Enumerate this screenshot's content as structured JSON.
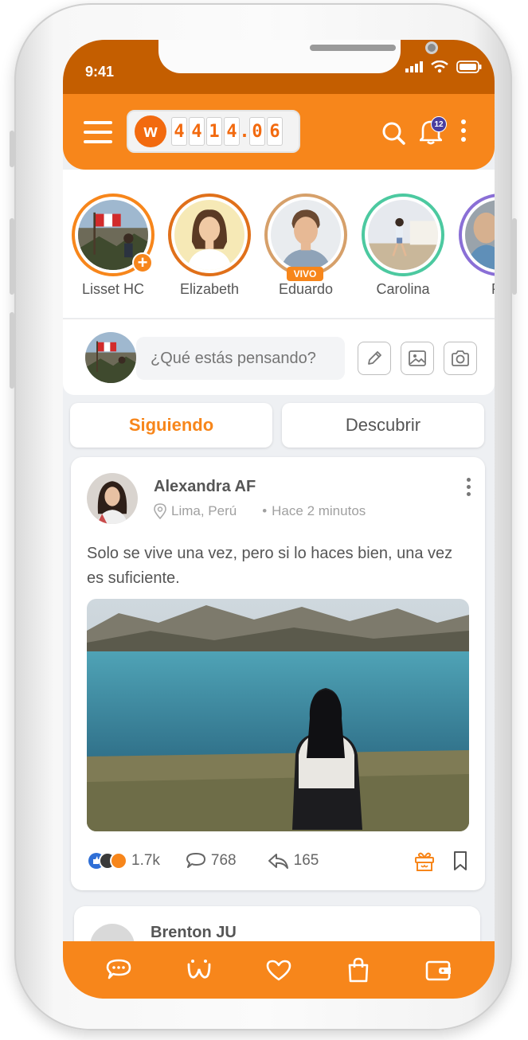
{
  "status_bar": {
    "time": "9:41"
  },
  "header": {
    "counter_digits": [
      "4",
      "4",
      "1",
      "4",
      ".",
      "0",
      "6"
    ],
    "logo_letter": "w",
    "notification_count": "12",
    "accent_color": "#f7861b"
  },
  "stories": [
    {
      "name": "Lisset HC",
      "badge": "+",
      "ring_color": "#f7861b"
    },
    {
      "name": "Elizabeth",
      "ring_color": "#e0701a"
    },
    {
      "name": "Eduardo",
      "badge": "VIVO",
      "ring_color": "#d6a06a"
    },
    {
      "name": "Carolina",
      "ring_color": "#4cc9a0"
    },
    {
      "name": "Ph",
      "ring_color": "#8a6fd6"
    }
  ],
  "composer": {
    "placeholder": "¿Qué estás pensando?"
  },
  "tabs": [
    {
      "label": "Siguiendo",
      "active": true
    },
    {
      "label": "Descubrir",
      "active": false
    }
  ],
  "post": {
    "author": "Alexandra AF",
    "location": "Lima, Perú",
    "time": "Hace 2 minutos",
    "text": "Solo se vive una vez, pero si lo haces bien, una vez es suficiente.",
    "reactions": "1.7k",
    "comments": "768",
    "shares": "165"
  },
  "next_post": {
    "author": "Brenton JU"
  },
  "bottom_nav": [
    "chat-icon",
    "home-logo-icon",
    "heart-icon",
    "shopping-bag-icon",
    "wallet-icon"
  ]
}
